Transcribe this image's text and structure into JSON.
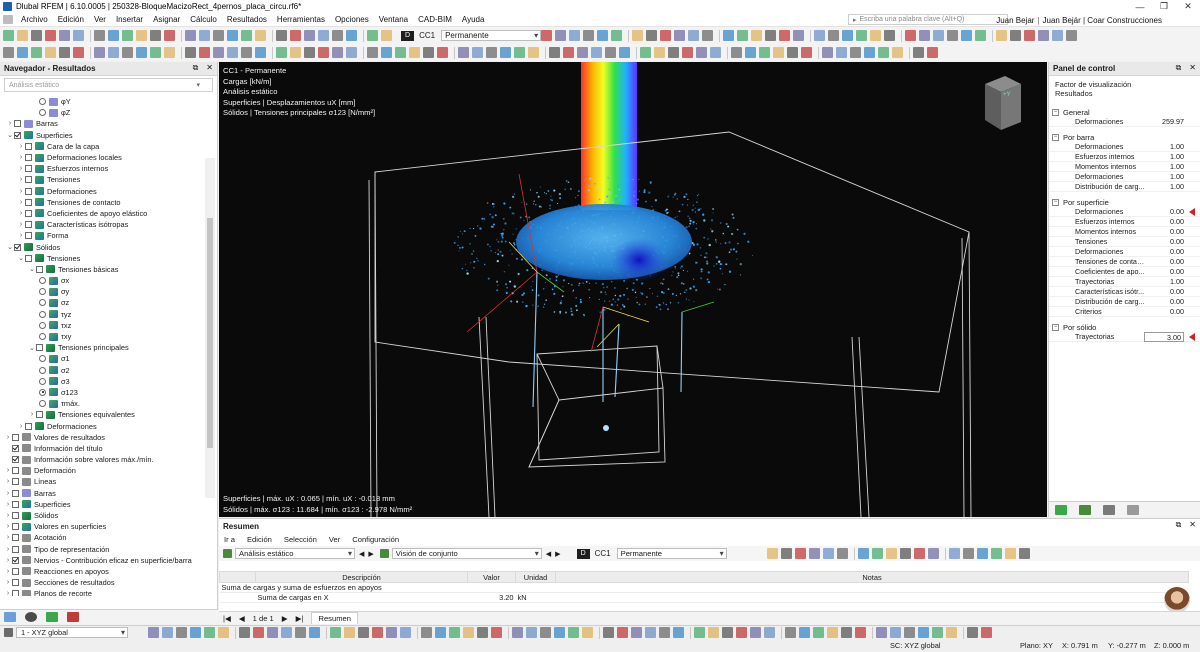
{
  "window": {
    "title": "Dlubal RFEM | 6.10.0005 | 250328-BloqueMacizoRect_4pernos_placa_circu.rf6*",
    "minimize": "—",
    "maximize": "❐",
    "close": "✕"
  },
  "menu": {
    "items": [
      "Archivo",
      "Edición",
      "Ver",
      "Insertar",
      "Asignar",
      "Cálculo",
      "Resultados",
      "Herramientas",
      "Opciones",
      "Ventana",
      "CAD-BIM",
      "Ayuda"
    ],
    "search_placeholder": "Escriba una palabra clave (Alt+Q)",
    "user_primary": "Juan Bejar",
    "user_secondary": "Juan Bejár | Coar Construcciones"
  },
  "toolbar": {
    "load_case_tag": "D",
    "load_case_code": "CC1",
    "load_case_name": "Permanente"
  },
  "navigator": {
    "title": "Navegador - Resultados",
    "filter_value": "Análisis estático",
    "tree": [
      {
        "level": 3,
        "kind": "radio",
        "checked": false,
        "icon": "bar",
        "label": "φY"
      },
      {
        "level": 3,
        "kind": "radio",
        "checked": false,
        "icon": "bar",
        "label": "φZ"
      },
      {
        "level": 0,
        "exp": ">",
        "kind": "check",
        "checked": false,
        "icon": "bar",
        "label": "Barras"
      },
      {
        "level": 0,
        "exp": "v",
        "kind": "check",
        "checked": true,
        "icon": "surf",
        "label": "Superficies"
      },
      {
        "level": 1,
        "exp": ">",
        "kind": "check",
        "checked": false,
        "icon": "surf",
        "label": "Cara de la capa"
      },
      {
        "level": 1,
        "exp": ">",
        "kind": "check",
        "checked": false,
        "icon": "surf",
        "label": "Deformaciones locales"
      },
      {
        "level": 1,
        "exp": ">",
        "kind": "check",
        "checked": false,
        "icon": "surf",
        "label": "Esfuerzos internos"
      },
      {
        "level": 1,
        "exp": ">",
        "kind": "check",
        "checked": false,
        "icon": "surf",
        "label": "Tensiones"
      },
      {
        "level": 1,
        "exp": ">",
        "kind": "check",
        "checked": false,
        "icon": "surf",
        "label": "Deformaciones"
      },
      {
        "level": 1,
        "exp": ">",
        "kind": "check",
        "checked": false,
        "icon": "surf",
        "label": "Tensiones de contacto"
      },
      {
        "level": 1,
        "exp": ">",
        "kind": "check",
        "checked": false,
        "icon": "surf",
        "label": "Coeficientes de apoyo elástico"
      },
      {
        "level": 1,
        "exp": ">",
        "kind": "check",
        "checked": false,
        "icon": "surf",
        "label": "Características isótropas"
      },
      {
        "level": 1,
        "exp": ">",
        "kind": "check",
        "checked": false,
        "icon": "surf",
        "label": "Forma"
      },
      {
        "level": 0,
        "exp": "v",
        "kind": "check",
        "checked": true,
        "icon": "solid",
        "label": "Sólidos"
      },
      {
        "level": 1,
        "exp": "v",
        "kind": "check",
        "checked": false,
        "icon": "solid",
        "label": "Tensiones"
      },
      {
        "level": 2,
        "exp": "v",
        "kind": "check",
        "checked": false,
        "icon": "solid",
        "label": "Tensiones básicas"
      },
      {
        "level": 3,
        "kind": "radio",
        "checked": false,
        "icon": "stress",
        "label": "σx"
      },
      {
        "level": 3,
        "kind": "radio",
        "checked": false,
        "icon": "stress",
        "label": "σy"
      },
      {
        "level": 3,
        "kind": "radio",
        "checked": false,
        "icon": "stress",
        "label": "σz"
      },
      {
        "level": 3,
        "kind": "radio",
        "checked": false,
        "icon": "stress",
        "label": "τyz"
      },
      {
        "level": 3,
        "kind": "radio",
        "checked": false,
        "icon": "stress",
        "label": "τxz"
      },
      {
        "level": 3,
        "kind": "radio",
        "checked": false,
        "icon": "stress",
        "label": "τxy"
      },
      {
        "level": 2,
        "exp": "v",
        "kind": "check",
        "checked": false,
        "icon": "solid",
        "label": "Tensiones principales"
      },
      {
        "level": 3,
        "kind": "radio",
        "checked": false,
        "icon": "stress",
        "label": "σ1"
      },
      {
        "level": 3,
        "kind": "radio",
        "checked": false,
        "icon": "stress",
        "label": "σ2"
      },
      {
        "level": 3,
        "kind": "radio",
        "checked": false,
        "icon": "stress",
        "label": "σ3"
      },
      {
        "level": 3,
        "kind": "radio",
        "checked": true,
        "icon": "stress",
        "label": "σ123"
      },
      {
        "level": 3,
        "kind": "radio",
        "checked": false,
        "icon": "stress",
        "label": "τmáx."
      },
      {
        "level": 2,
        "exp": ">",
        "kind": "check",
        "checked": false,
        "icon": "solid",
        "label": "Tensiones equivalentes"
      },
      {
        "level": 1,
        "exp": ">",
        "kind": "check",
        "checked": false,
        "icon": "solid",
        "label": "Deformaciones"
      },
      {
        "level": -1,
        "exp": ">",
        "kind": "check",
        "checked": false,
        "icon": "gray",
        "label": "Valores de resultados"
      },
      {
        "level": -1,
        "exp": "",
        "kind": "check",
        "checked": true,
        "icon": "gray",
        "label": "Información del título"
      },
      {
        "level": -1,
        "exp": "",
        "kind": "check",
        "checked": true,
        "icon": "gray",
        "label": "Información sobre valores máx./mín."
      },
      {
        "level": -1,
        "exp": ">",
        "kind": "check",
        "checked": false,
        "icon": "gray",
        "label": "Deformación"
      },
      {
        "level": -1,
        "exp": ">",
        "kind": "check",
        "checked": false,
        "icon": "gray",
        "label": "Líneas"
      },
      {
        "level": -1,
        "exp": ">",
        "kind": "check",
        "checked": false,
        "icon": "bar",
        "label": "Barras"
      },
      {
        "level": -1,
        "exp": ">",
        "kind": "check",
        "checked": false,
        "icon": "surf",
        "label": "Superficies"
      },
      {
        "level": -1,
        "exp": ">",
        "kind": "check",
        "checked": false,
        "icon": "solid",
        "label": "Sólidos"
      },
      {
        "level": -1,
        "exp": ">",
        "kind": "check",
        "checked": false,
        "icon": "surf",
        "label": "Valores en superficies"
      },
      {
        "level": -1,
        "exp": ">",
        "kind": "check",
        "checked": false,
        "icon": "gray",
        "label": "Acotación"
      },
      {
        "level": -1,
        "exp": ">",
        "kind": "check",
        "checked": false,
        "icon": "gray",
        "label": "Tipo de representación"
      },
      {
        "level": -1,
        "exp": ">",
        "kind": "check",
        "checked": true,
        "icon": "gray",
        "label": "Nervios - Contribución eficaz en superficie/barra"
      },
      {
        "level": -1,
        "exp": ">",
        "kind": "check",
        "checked": false,
        "icon": "gray",
        "label": "Reacciones en apoyos"
      },
      {
        "level": -1,
        "exp": ">",
        "kind": "check",
        "checked": false,
        "icon": "gray",
        "label": "Secciones de resultados"
      },
      {
        "level": -1,
        "exp": ">",
        "kind": "check",
        "checked": false,
        "icon": "gray",
        "label": "Planos de recorte"
      }
    ]
  },
  "viewport": {
    "info_lines": [
      "CC1 - Permanente",
      "Cargas [kN/m]",
      "Análisis estático",
      "Superficies | Desplazamientos uX [mm]",
      "Sólidos | Tensiones principales σ123 [N/mm²]"
    ],
    "bottom_lines": [
      "Superficies | máx. uX : 0.065 | mín. uX : -0.018 mm",
      "Sólidos | máx. σ123 : 11.684 | mín. σ123 : -2.978 N/mm²"
    ],
    "viewcube_label": "+Y"
  },
  "control_panel": {
    "title": "Panel de control",
    "description_1": "Factor de visualización",
    "description_2": "Resultados",
    "groups": [
      {
        "name": "General",
        "rows": [
          {
            "label": "Deformaciones",
            "value": "259.97"
          }
        ]
      },
      {
        "name": "Por barra",
        "rows": [
          {
            "label": "Deformaciones",
            "value": "1.00"
          },
          {
            "label": "Esfuerzos internos",
            "value": "1.00"
          },
          {
            "label": "Momentos internos",
            "value": "1.00"
          },
          {
            "label": "Deformaciones",
            "value": "1.00"
          },
          {
            "label": "Distribución de carg...",
            "value": "1.00"
          }
        ]
      },
      {
        "name": "Por superficie",
        "rows": [
          {
            "label": "Deformaciones",
            "value": "0.00",
            "marker": true
          },
          {
            "label": "Esfuerzos internos",
            "value": "0.00"
          },
          {
            "label": "Momentos internos",
            "value": "0.00"
          },
          {
            "label": "Tensiones",
            "value": "0.00"
          },
          {
            "label": "Deformaciones",
            "value": "0.00"
          },
          {
            "label": "Tensiones de contac...",
            "value": "0.00"
          },
          {
            "label": "Coeficientes de apo...",
            "value": "0.00"
          },
          {
            "label": "Trayectorias",
            "value": "1.00"
          },
          {
            "label": "Características isótr...",
            "value": "0.00"
          },
          {
            "label": "Distribución de carg...",
            "value": "0.00"
          },
          {
            "label": "Criterios",
            "value": "0.00"
          }
        ]
      },
      {
        "name": "Por sólido",
        "rows": [
          {
            "label": "Trayectorias",
            "value": "3.00",
            "boxed": true,
            "marker": true
          }
        ]
      }
    ]
  },
  "summary": {
    "title": "Resumen",
    "menu": [
      "Ir a",
      "Edición",
      "Selección",
      "Ver",
      "Configuración"
    ],
    "analysis": "Análisis estático",
    "view": "Visión de conjunto",
    "lc_tag": "D",
    "lc_code": "CC1",
    "lc_name": "Permanente",
    "headers": [
      "Descripción",
      "Valor",
      "Unidad",
      "Notas"
    ],
    "group_row": "Suma de cargas y suma de esfuerzos en apoyos",
    "rows": [
      {
        "desc": "Suma de cargas en X",
        "value": "3.20",
        "unit": "kN",
        "note": ""
      }
    ],
    "pager": "1 de 1",
    "tab": "Resumen"
  },
  "status": {
    "coord_system": "1 - XYZ global",
    "sc": "SC: XYZ global",
    "plane": "Plano: XY",
    "x": "X: 0.791 m",
    "y": "Y: -0.277 m",
    "z": "Z: 0.000 m"
  },
  "colors": {
    "navigator_accent": "#1e5fa8",
    "viewport_bg": "#0a0a0a",
    "marker_red": "#d0202a",
    "stress_blue": "#3aa7ff"
  }
}
